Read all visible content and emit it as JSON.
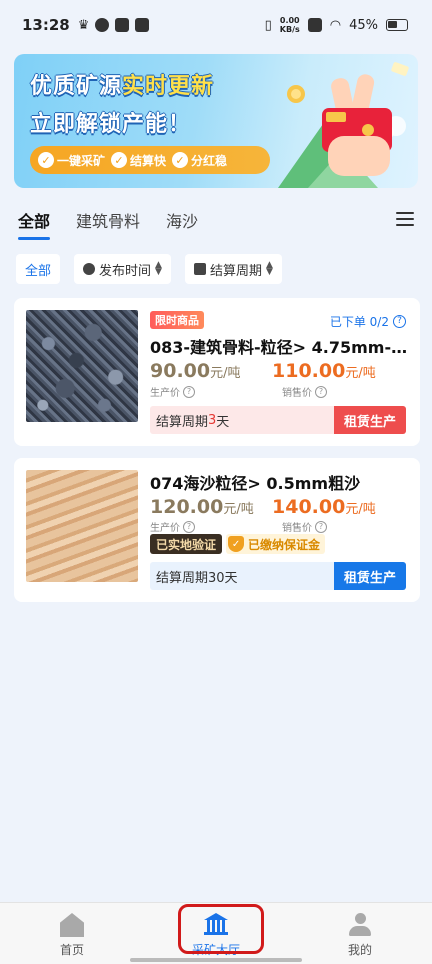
{
  "status_bar": {
    "time": "13:28",
    "netspeed_value": "0.00",
    "netspeed_unit": "KB/s",
    "battery": "45%"
  },
  "banner": {
    "line1_a": "优质矿源",
    "line1_b": "实时更新",
    "line2": "立即解锁产能！",
    "pills": [
      "一键采矿",
      "结算快",
      "分红稳"
    ]
  },
  "tabs": [
    {
      "label": "全部",
      "active": true
    },
    {
      "label": "建筑骨料",
      "active": false
    },
    {
      "label": "海沙",
      "active": false
    }
  ],
  "filters": {
    "all": "全部",
    "publish_time": "发布时间",
    "settle_cycle": "结算周期"
  },
  "products": [
    {
      "badge": "限时商品",
      "ordered": "已下单 0/2",
      "title": "083-建筑骨料-粒径> 4.75mm-…",
      "production_price": "90.00",
      "production_unit": "元/吨",
      "production_label": "生产价",
      "sale_price": "110.00",
      "sale_unit": "元/吨",
      "sale_label": "销售价",
      "settle_prefix": "结算周期",
      "settle_days": "3",
      "settle_suffix": "天",
      "button": "租赁生产"
    },
    {
      "title": "074海沙粒径> 0.5mm粗沙",
      "production_price": "120.00",
      "production_unit": "元/吨",
      "production_label": "生产价",
      "sale_price": "140.00",
      "sale_unit": "元/吨",
      "sale_label": "销售价",
      "tag_verified": "已实地验证",
      "tag_deposit": "已缴纳保证金",
      "settle_text": "结算周期30天",
      "button": "租赁生产"
    }
  ],
  "bottom_nav": [
    {
      "label": "首页",
      "icon": "home-icon"
    },
    {
      "label": "采矿大厅",
      "icon": "hall-icon"
    },
    {
      "label": "我的",
      "icon": "user-icon"
    }
  ],
  "colors": {
    "accent": "#1a73e8",
    "sale_price": "#ec6c21",
    "alert": "#ee4d4d",
    "highlight": "#d11a1a"
  }
}
